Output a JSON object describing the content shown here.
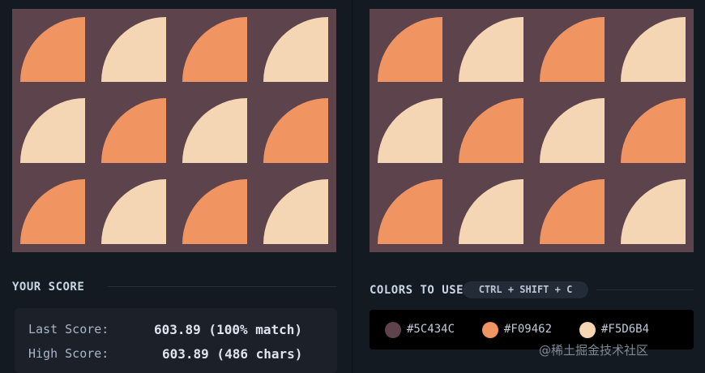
{
  "colors": {
    "background": "#5C434C",
    "primary": "#F09462",
    "secondary": "#F5D6B4"
  },
  "left_art": {
    "name": "output-preview"
  },
  "right_art": {
    "name": "target-image"
  },
  "score": {
    "heading": "YOUR SCORE",
    "last_label": "Last Score:",
    "last_value": "603.89 (100% match)",
    "high_label": "High Score:",
    "high_value": "603.89 (486 chars)"
  },
  "palette": {
    "heading": "COLORS TO USE",
    "shortcut": "CTRL + SHIFT + C",
    "chips": [
      {
        "label": "#5C434C",
        "color": "#5C434C"
      },
      {
        "label": "#F09462",
        "color": "#F09462"
      },
      {
        "label": "#F5D6B4",
        "color": "#F5D6B4"
      }
    ]
  },
  "watermark": "@稀土掘金技术社区"
}
